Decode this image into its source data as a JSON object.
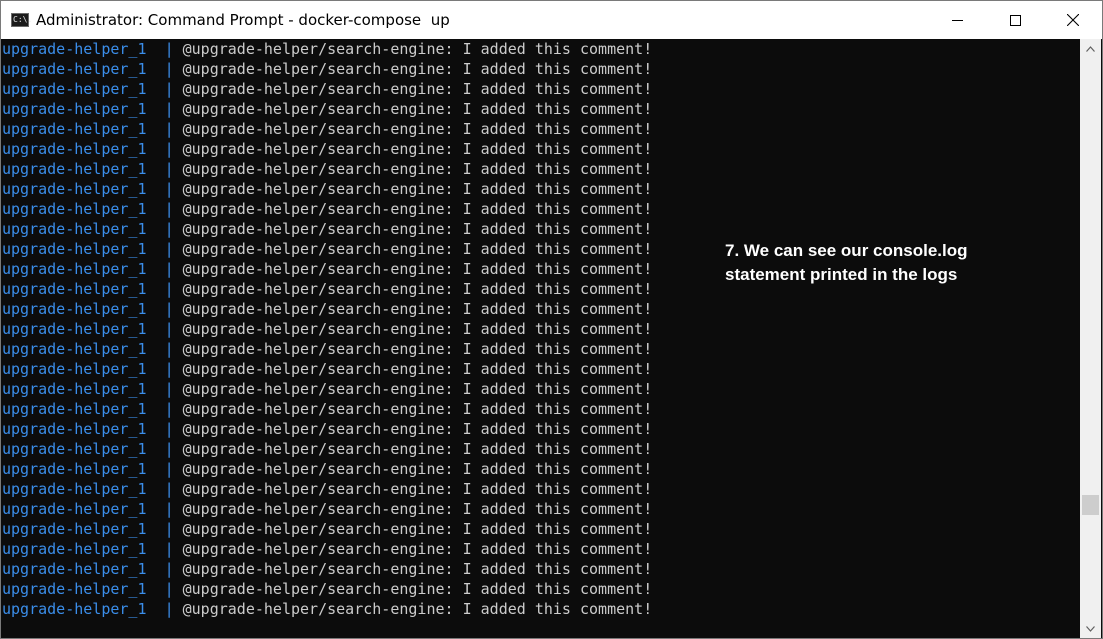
{
  "window": {
    "title": "Administrator: Command Prompt - docker-compose  up",
    "app_icon": "cmd-icon",
    "app_icon_glyph": "C:\\.",
    "controls": [
      "minimize",
      "maximize",
      "close"
    ]
  },
  "console": {
    "service_name": "upgrade-helper_1",
    "separator": "|",
    "lines": [
      "@upgrade-helper/search-engine: I added this comment!",
      "@upgrade-helper/search-engine: I added this comment!",
      "@upgrade-helper/search-engine: I added this comment!",
      "@upgrade-helper/search-engine: I added this comment!",
      "@upgrade-helper/search-engine: I added this comment!",
      "@upgrade-helper/search-engine: I added this comment!",
      "@upgrade-helper/search-engine: I added this comment!",
      "@upgrade-helper/search-engine: I added this comment!",
      "@upgrade-helper/search-engine: I added this comment!",
      "@upgrade-helper/search-engine: I added this comment!",
      "@upgrade-helper/search-engine: I added this comment!",
      "@upgrade-helper/search-engine: I added this comment!",
      "@upgrade-helper/search-engine: I added this comment!",
      "@upgrade-helper/search-engine: I added this comment!",
      "@upgrade-helper/search-engine: I added this comment!",
      "@upgrade-helper/search-engine: I added this comment!",
      "@upgrade-helper/search-engine: I added this comment!",
      "@upgrade-helper/search-engine: I added this comment!",
      "@upgrade-helper/search-engine: I added this comment!",
      "@upgrade-helper/search-engine: I added this comment!",
      "@upgrade-helper/search-engine: I added this comment!",
      "@upgrade-helper/search-engine: I added this comment!",
      "@upgrade-helper/search-engine: I added this comment!",
      "@upgrade-helper/search-engine: I added this comment!",
      "@upgrade-helper/search-engine: I added this comment!",
      "@upgrade-helper/search-engine: I added this comment!",
      "@upgrade-helper/search-engine: I added this comment!",
      "@upgrade-helper/search-engine: I added this comment!",
      "@upgrade-helper/search-engine: I added this comment!"
    ]
  },
  "annotation": {
    "line1": "7. We can see our console.log",
    "line2": "statement printed in the logs"
  },
  "scrollbar": {
    "up_icon": "chevron-up-icon",
    "down_icon": "chevron-down-icon",
    "position": 0.8
  },
  "colors": {
    "service": "#3b8eea",
    "message": "#cccccc",
    "background": "#0c0c0c"
  }
}
